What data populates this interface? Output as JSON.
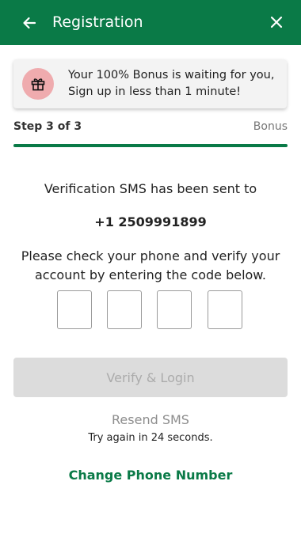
{
  "header": {
    "title": "Registration",
    "back_icon": "arrow-left-icon",
    "close_icon": "close-icon",
    "background": "#0a7a47"
  },
  "bonus_banner": {
    "icon": "gift-icon",
    "text": "Your 100% Bonus is waiting for you, Sign up in less than 1 minute!"
  },
  "progress": {
    "step_label": "Step 3 of 3",
    "end_label": "Bonus",
    "percent": 100
  },
  "verification": {
    "sent_message": "Verification SMS has been sent to",
    "phone_number": "+1 2509991899",
    "instructions": "Please check your phone and verify your account by entering the code below.",
    "code_digits": [
      "",
      "",
      "",
      ""
    ]
  },
  "actions": {
    "verify_label": "Verify & Login",
    "resend_label": "Resend SMS",
    "retry_text": "Try again in 24 seconds.",
    "change_phone_label": "Change Phone Number"
  },
  "colors": {
    "accent": "#0a7a47",
    "gift_circle": "#efabae",
    "disabled_button": "#dcdcdc"
  }
}
